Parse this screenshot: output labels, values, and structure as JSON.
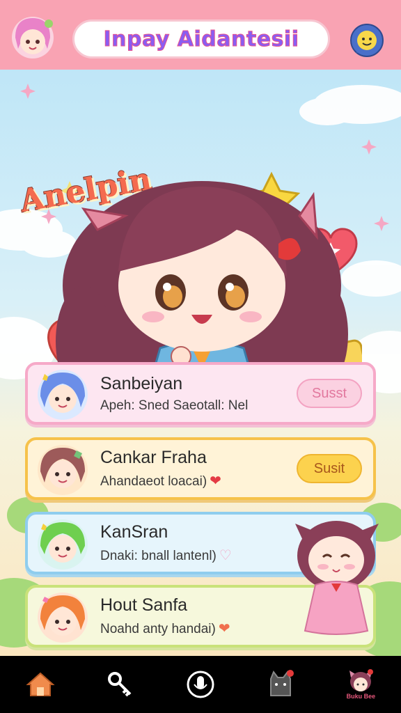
{
  "header": {
    "title": "Inpay Aidantesii",
    "avatar_icon": "chibi-girl-avatar-icon",
    "chat_icon": "chat-bubble-icon"
  },
  "hero": {
    "tag": "Anelpin",
    "character": "chibi-girl-with-cat-ears-icon"
  },
  "list": [
    {
      "name": "Sanbeiyan",
      "subtitle": "Apeh: Sned Saeotall: Nel",
      "button": "Susst",
      "heart": ""
    },
    {
      "name": "Cankar Fraha",
      "subtitle": "Ahandaeot loacai)",
      "button": "Susit",
      "heart": "❤"
    },
    {
      "name": "KanSran",
      "subtitle": "Dnaki: bnall lantenl)",
      "button": "",
      "heart": "♡"
    },
    {
      "name": "Hout Sanfa",
      "subtitle": "Noahd anty handai)",
      "button": "",
      "heart": "❤"
    }
  ],
  "nav": {
    "items": [
      "home-icon",
      "key-icon",
      "microphone-icon",
      "cat-icon",
      "profile-icon"
    ],
    "profile_badge": "Buku Bee"
  },
  "colors": {
    "header_bg": "#f9a3b3",
    "accent_pink": "#f6a9c8",
    "accent_yellow": "#f6c24a",
    "accent_blue": "#8fcdee",
    "accent_green": "#c9e27a"
  }
}
